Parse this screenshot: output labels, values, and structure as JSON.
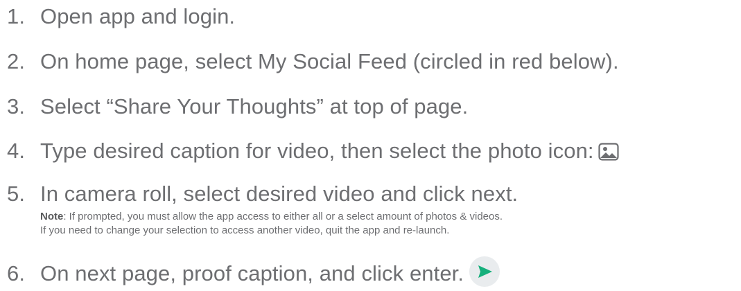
{
  "steps": [
    {
      "num": "1.",
      "text": "Open app and login."
    },
    {
      "num": "2.",
      "text": "On home page, select My Social Feed (circled in red below)."
    },
    {
      "num": "3.",
      "text": "Select “Share Your Thoughts” at top of page."
    },
    {
      "num": "4.",
      "text": "Type desired caption for video, then select the photo icon:"
    },
    {
      "num": "5.",
      "text": "In camera roll, select desired video and click next."
    },
    {
      "num": "6.",
      "text": "On next page, proof caption, and click enter."
    }
  ],
  "note": {
    "label": "Note",
    "line1": ": If prompted, you must allow the app access to either all or a select amount of photos & videos.",
    "line2": "If you need to change your selection to access another video, quit the app and re-launch."
  },
  "icons": {
    "photo": "photo-icon",
    "send": "send-icon"
  },
  "colors": {
    "text": "#6d6e71",
    "send_arrow": "#16b07c",
    "send_bg": "#e9ecee"
  }
}
